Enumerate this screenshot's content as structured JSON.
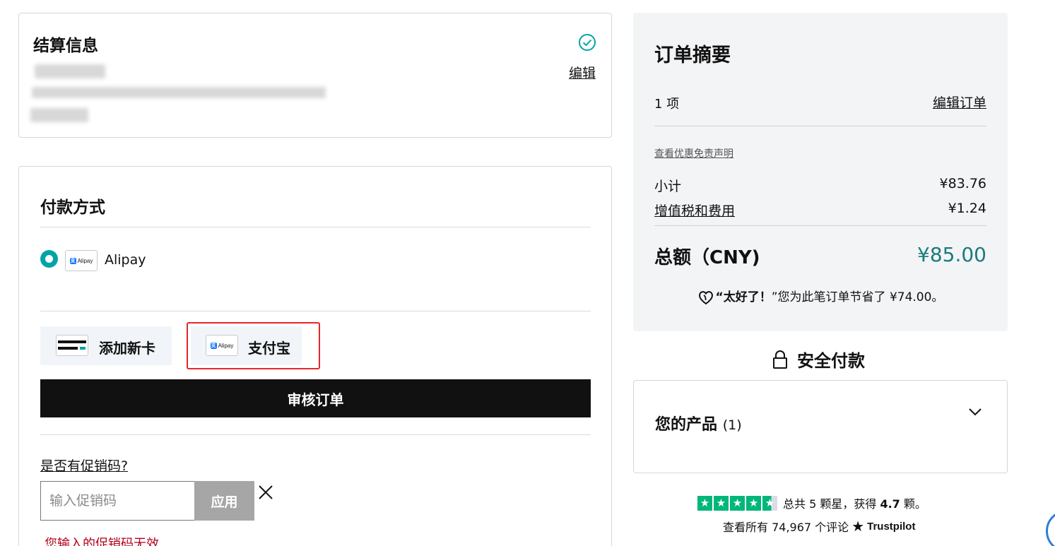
{
  "billing": {
    "title": "结算信息",
    "edit_label": "编辑"
  },
  "payment": {
    "title": "付款方式",
    "selected_method": "Alipay",
    "alipay_logo_text": "Alipay",
    "add_card_label": "添加新卡",
    "alipay_cn_label": "支付宝",
    "review_button": "审核订单",
    "promo_question": "是否有促销码?",
    "promo_placeholder": "输入促销码",
    "apply_button": "应用",
    "promo_error": "您输入的促销码无效"
  },
  "summary": {
    "title": "订单摘要",
    "items_count": "1 项",
    "edit_order": "编辑订单",
    "disclaimer": "查看优惠免责声明",
    "subtotal_label": "小计",
    "subtotal_value": "¥83.76",
    "tax_label": "增值税和费用",
    "tax_value": "¥1.24",
    "total_label": "总额（CNY)",
    "total_value": "¥85.00",
    "savings_exclaim": "“太好了！",
    "savings_text": "”您为此笔订单节省了 ¥74.00。"
  },
  "secure": {
    "label": "安全付款"
  },
  "products": {
    "title": "您的产品",
    "count": "(1)"
  },
  "trustpilot": {
    "rating_text_a": "总共 5 颗星，获得 ",
    "rating_value": "4.7",
    "rating_text_b": " 颗。",
    "reviews_text": "查看所有 74,967 个评论",
    "brand": "Trustpilot"
  },
  "colors": {
    "accent_teal": "#00a4a6",
    "total_green": "#1b7a7c",
    "highlight_red": "#e5262b",
    "trustpilot_green": "#00b67a"
  }
}
